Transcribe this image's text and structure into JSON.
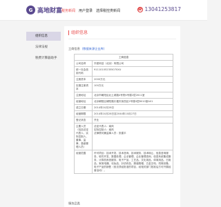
{
  "header": {
    "logo_mark": "G",
    "logo_text": "高地财富",
    "nav": [
      {
        "label": "税务新闻",
        "active": true
      },
      {
        "label": "用户登录",
        "active": false
      },
      {
        "label": "选择税控类新闻",
        "active": false
      }
    ],
    "phone_icon": "phone-icon",
    "phone": "13041253817"
  },
  "sidebar": {
    "items": [
      {
        "label": "组织信息",
        "active": true
      },
      {
        "label": "法律法规",
        "active": false
      },
      {
        "label": "税费计算器助手",
        "active": false
      }
    ]
  },
  "main": {
    "title": "组织信息",
    "subhead_label": "工商信息",
    "subhead_tag": "(数据来源企业库)",
    "table_header": "工商信息",
    "rows": [
      {
        "k": "公司名称",
        "v": "华夏科技（北京）有限公司"
      },
      {
        "k": "统一社会信用代码",
        "v": "911101052355070XU"
      },
      {
        "k": "注册资本",
        "v": "2000万元"
      },
      {
        "k": "实缴注册资本",
        "v": "100万元"
      },
      {
        "k": "注册地址",
        "v": "北京市朝阳区北土城路4号院4号楼2层2611室"
      },
      {
        "k": "经营地址",
        "v": "北京朝阳区朝阳路长楹天街西区2号楼4层8010室A01"
      },
      {
        "k": "成立日期",
        "v": "2014年10月28日"
      },
      {
        "k": "经营期限",
        "v": "2014年10月28日至2044年10月27日"
      },
      {
        "k": "登记状态",
        "v": "开业"
      },
      {
        "k": "主要人员（包括法定代表人、实际控制人、董事、监事、高级管理人员）",
        "v": "法定代表人：南风\n实际控制人：南风\n法律顾问兼监事人员：张建平"
      },
      {
        "k": "经营范围",
        "v": "许可项目：技术开发、技术咨询、技术服务、技术转让、信息咨询服务、软件开发、数据处理、企业管理、企业管理咨询、信息系统集成服务、计算机系统服务、电子产品、工艺品、文化用品、体育用品、日用品、家用电器、化妆品、针纺织品、服装鞋帽、五金交电、机械设备、电子产品的销售（依法须经批准的项目，经相关部门批准后方可开展经营活动）。"
      }
    ],
    "footer_heading": "服务品类"
  },
  "colors": {
    "accent": "#e94e4e",
    "brand": "#5a4a8f",
    "link": "#3a6ad4"
  }
}
